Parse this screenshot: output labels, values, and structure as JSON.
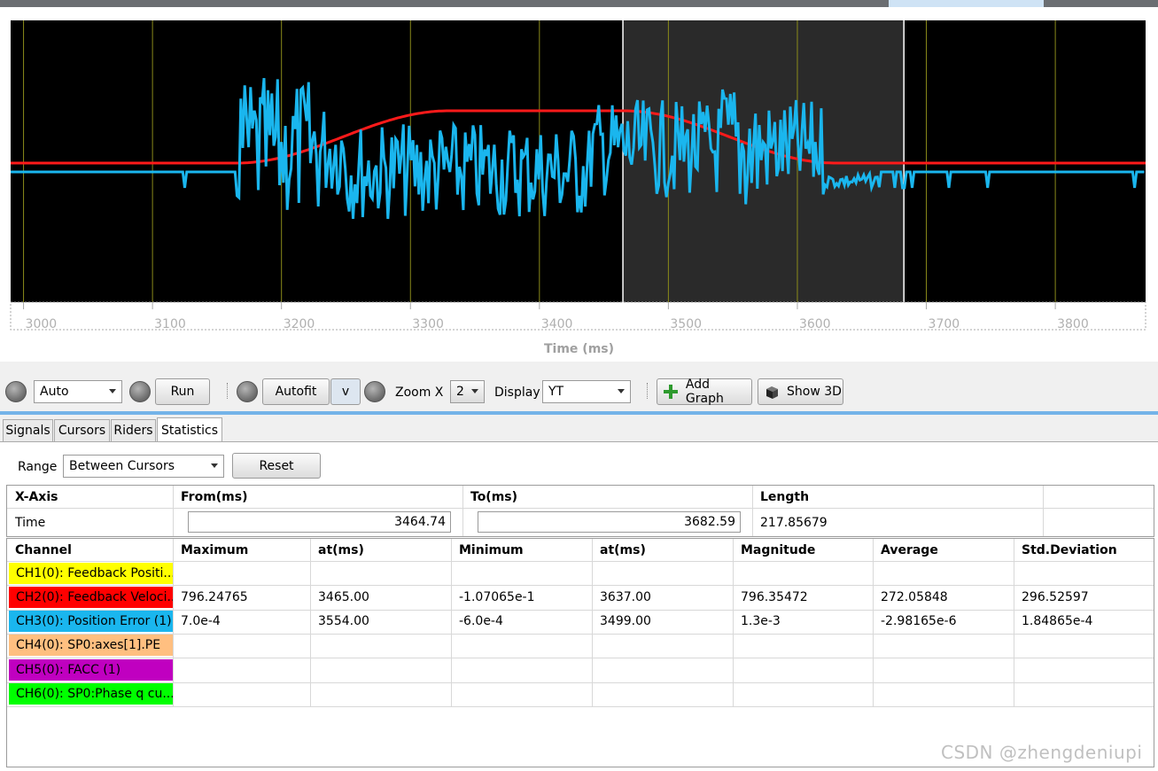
{
  "plot": {
    "x_axis_title": "Time (ms)",
    "x_ticks": [
      "3000",
      "3100",
      "3200",
      "3300",
      "3400",
      "3500",
      "3600",
      "3700",
      "3800"
    ],
    "x_range_ms": [
      2990,
      3870
    ],
    "cursor_region_ms": [
      3464.74,
      3682.59
    ],
    "colors": {
      "background": "#000000",
      "cursor_region": "#2a2a2a",
      "gridline": "#8a8a1a",
      "velocity": "#ff1a1a",
      "position_error": "#1ab6ee"
    }
  },
  "toolbar": {
    "trigger_mode": "Auto",
    "run_label": "Run",
    "autofit_label": "Autofit",
    "v_label": "v",
    "zoom_x_label": "Zoom X",
    "zoom_x_value": "2",
    "display_label": "Display",
    "display_value": "YT",
    "add_graph_label": "Add Graph",
    "show_3d_label": "Show 3D"
  },
  "tabs": [
    {
      "label": "Signals"
    },
    {
      "label": "Cursors"
    },
    {
      "label": "Riders"
    },
    {
      "label": "Statistics"
    }
  ],
  "range": {
    "label": "Range",
    "value": "Between Cursors",
    "reset_label": "Reset"
  },
  "xaxis_table": {
    "headers": [
      "X-Axis",
      "From(ms)",
      "To(ms)",
      "Length"
    ],
    "row": {
      "name": "Time",
      "from": "3464.74",
      "to": "3682.59",
      "length": "217.85679"
    }
  },
  "stats_table": {
    "headers": [
      "Channel",
      "Maximum",
      "at(ms)",
      "Minimum",
      "at(ms)",
      "Magnitude",
      "Average",
      "Std.Deviation"
    ],
    "rows": [
      {
        "channel": "CH1(0): Feedback Positi...",
        "color": "#ffff00",
        "values": [
          "",
          "",
          "",
          "",
          "",
          "",
          ""
        ]
      },
      {
        "channel": "CH2(0): Feedback Veloci...",
        "color": "#ff0000",
        "values": [
          "796.24765",
          "3465.00",
          "-1.07065e-1",
          "3637.00",
          "796.35472",
          "272.05848",
          "296.52597"
        ]
      },
      {
        "channel": "CH3(0): Position Error (1)",
        "color": "#1ab6ee",
        "values": [
          "7.0e-4",
          "3554.00",
          "-6.0e-4",
          "3499.00",
          "1.3e-3",
          "-2.98165e-6",
          "1.84865e-4"
        ]
      },
      {
        "channel": "CH4(0): SP0:axes[1].PE",
        "color": "#ffbf80",
        "values": [
          "",
          "",
          "",
          "",
          "",
          "",
          ""
        ]
      },
      {
        "channel": "CH5(0): FACC (1)",
        "color": "#c000c0",
        "values": [
          "",
          "",
          "",
          "",
          "",
          "",
          ""
        ]
      },
      {
        "channel": "CH6(0): SP0:Phase q cu...",
        "color": "#00ff00",
        "values": [
          "",
          "",
          "",
          "",
          "",
          "",
          ""
        ]
      }
    ]
  },
  "watermark": "CSDN @zhengdeniupi"
}
